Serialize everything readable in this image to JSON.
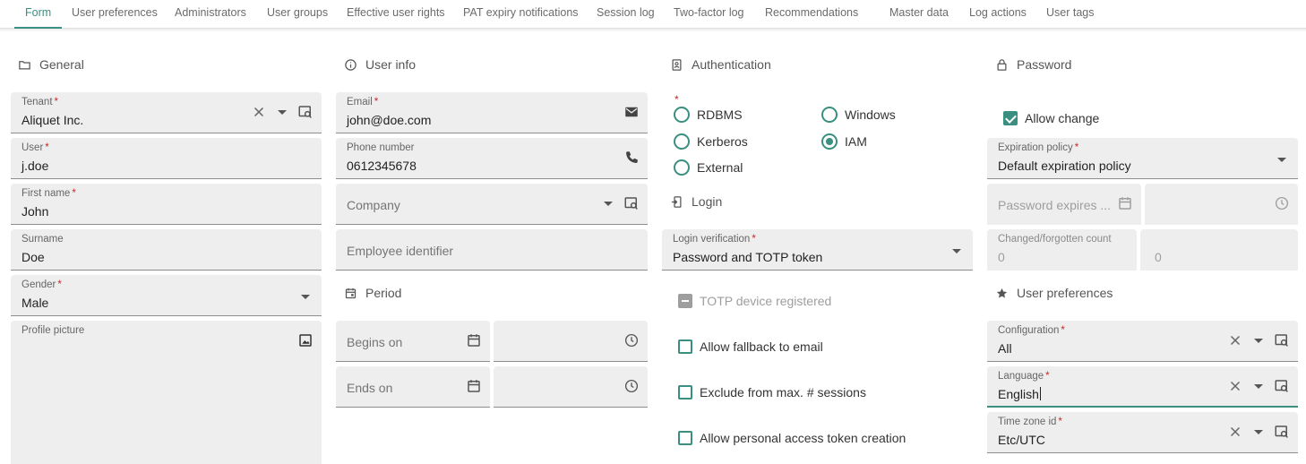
{
  "tabs": [
    "Form",
    "User preferences",
    "Administrators",
    "User groups",
    "Effective user rights",
    "PAT expiry notifications",
    "Session log",
    "Two-factor log",
    "Recommendations",
    "Master data",
    "Log actions",
    "User tags"
  ],
  "sections": {
    "general": "General",
    "user_info": "User info",
    "authentication": "Authentication",
    "password": "Password",
    "login": "Login",
    "period": "Period",
    "user_preferences": "User preferences"
  },
  "general": {
    "tenant": {
      "label": "Tenant",
      "value": "Aliquet Inc."
    },
    "user": {
      "label": "User",
      "value": "j.doe"
    },
    "first_name": {
      "label": "First name",
      "value": "John"
    },
    "surname": {
      "label": "Surname",
      "value": "Doe"
    },
    "gender": {
      "label": "Gender",
      "value": "Male"
    },
    "profile_picture": {
      "label": "Profile picture"
    }
  },
  "user_info": {
    "email": {
      "label": "Email",
      "value": "john@doe.com"
    },
    "phone": {
      "label": "Phone number",
      "value": "0612345678"
    },
    "company": {
      "placeholder": "Company"
    },
    "employee_identifier": {
      "placeholder": "Employee identifier"
    }
  },
  "period": {
    "begins_on": "Begins on",
    "ends_on": "Ends on"
  },
  "authentication": {
    "options": [
      "RDBMS",
      "Windows",
      "Kerberos",
      "IAM",
      "External"
    ],
    "selected": "IAM"
  },
  "login": {
    "verification": {
      "label": "Login verification",
      "value": "Password and TOTP token"
    },
    "totp_registered": "TOTP device registered",
    "allow_fallback": "Allow fallback to email",
    "exclude_sessions": "Exclude from max. # sessions",
    "allow_pat": "Allow personal access token creation"
  },
  "password": {
    "allow_change": "Allow change",
    "expiration_policy": {
      "label": "Expiration policy",
      "value": "Default expiration policy"
    },
    "expires_placeholder": "Password expires ...",
    "changed_count": {
      "label": "Changed/forgotten count",
      "value": "0"
    },
    "second_count": "0"
  },
  "preferences": {
    "configuration": {
      "label": "Configuration",
      "value": "All"
    },
    "language": {
      "label": "Language",
      "value": "English"
    },
    "timezone": {
      "label": "Time zone id",
      "value": "Etc/UTC"
    }
  },
  "required_mark": "*",
  "colors": {
    "accent": "#3a8f80",
    "required": "#c62828",
    "field_bg": "#eeeeee"
  },
  "icons": [
    "folder-icon",
    "info-icon",
    "badge-icon",
    "lock-icon",
    "login-icon",
    "calendar-icon",
    "star-icon",
    "clear-icon",
    "lookup-icon",
    "mail-icon",
    "phone-icon",
    "image-icon",
    "clock-icon",
    "caret-down-icon"
  ]
}
